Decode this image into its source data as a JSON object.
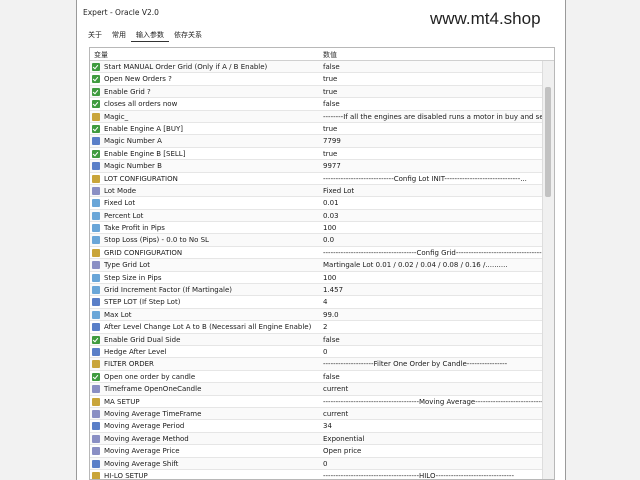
{
  "window": {
    "title": "Expert - Oracle V2.0",
    "watermark": "www.mt4.shop"
  },
  "tabs": [
    {
      "label": "关于"
    },
    {
      "label": "常用"
    },
    {
      "label": "输入参数"
    },
    {
      "label": "依存关系"
    }
  ],
  "table": {
    "col_variable": "变量",
    "col_value": "数值",
    "rows": [
      {
        "icon": "bool",
        "name": "Start MANUAL Order  Grid   (Only if A / B Enable)",
        "value": "false"
      },
      {
        "icon": "bool",
        "name": "Open New Orders ?",
        "value": "true"
      },
      {
        "icon": "bool",
        "name": "Enable Grid ?",
        "value": "true"
      },
      {
        "icon": "bool",
        "name": "closes all orders now",
        "value": "false"
      },
      {
        "icon": "str",
        "name": "Magic_",
        "value": "--------If all the engines are disabled runs a motor in buy and se..."
      },
      {
        "icon": "bool",
        "name": "Enable Engine A    [BUY]",
        "value": "true"
      },
      {
        "icon": "num",
        "name": "Magic Number  A",
        "value": "7799"
      },
      {
        "icon": "bool",
        "name": "Enable Engine B    [SELL]",
        "value": "true"
      },
      {
        "icon": "num",
        "name": "Magic Number  B",
        "value": "9977"
      },
      {
        "icon": "str",
        "name": "LOT CONFIGURATION",
        "value": "----------------------------Config Lot INIT------------------------------..."
      },
      {
        "icon": "enm",
        "name": "Lot Mode",
        "value": "Fixed Lot"
      },
      {
        "icon": "dbl",
        "name": "Fixed Lot",
        "value": "0.01"
      },
      {
        "icon": "dbl",
        "name": "Percent Lot",
        "value": "0.03"
      },
      {
        "icon": "dbl",
        "name": "Take Profit in Pips",
        "value": "100"
      },
      {
        "icon": "dbl",
        "name": "Stop Loss (Pips) - 0.0 to No SL",
        "value": "0.0"
      },
      {
        "icon": "str",
        "name": "GRID CONFIGURATION",
        "value": "-------------------------------------Config Grid--------------------------------------"
      },
      {
        "icon": "enm",
        "name": "Type Grid Lot",
        "value": "Martingale Lot  0.01 / 0.02 / 0.04 / 0.08 / 0.16 /.........."
      },
      {
        "icon": "dbl",
        "name": "Step Size in Pips",
        "value": "100"
      },
      {
        "icon": "dbl",
        "name": "Grid Increment Factor (If Martingale)",
        "value": "1.457"
      },
      {
        "icon": "num",
        "name": "STEP LOT (If  Step Lot)",
        "value": "4"
      },
      {
        "icon": "dbl",
        "name": "Max Lot",
        "value": "99.0"
      },
      {
        "icon": "num",
        "name": "After Level Change Lot A to B (Necessari all Engine Enable)",
        "value": "2"
      },
      {
        "icon": "bool",
        "name": "Enable Grid Dual Side",
        "value": "false"
      },
      {
        "icon": "num",
        "name": "Hedge After Level",
        "value": "0"
      },
      {
        "icon": "str",
        "name": "FILTER ORDER",
        "value": "--------------------Filter One Order by Candle----------------"
      },
      {
        "icon": "bool",
        "name": "Open one order by candle",
        "value": "false"
      },
      {
        "icon": "enm",
        "name": "Timeframe OpenOneCandle",
        "value": "current"
      },
      {
        "icon": "str",
        "name": "MA SETUP",
        "value": "--------------------------------------Moving Average----------------------------"
      },
      {
        "icon": "enm",
        "name": "Moving Average TimeFrame",
        "value": "current"
      },
      {
        "icon": "num",
        "name": "Moving Average Period",
        "value": "34"
      },
      {
        "icon": "enm",
        "name": "Moving Average Method",
        "value": "Exponential"
      },
      {
        "icon": "enm",
        "name": "Moving Average Price",
        "value": "Open price"
      },
      {
        "icon": "num",
        "name": "Moving Average Shift",
        "value": "0"
      },
      {
        "icon": "str",
        "name": "HI-LO SETUP",
        "value": "--------------------------------------HILO-------------------------------"
      }
    ]
  }
}
